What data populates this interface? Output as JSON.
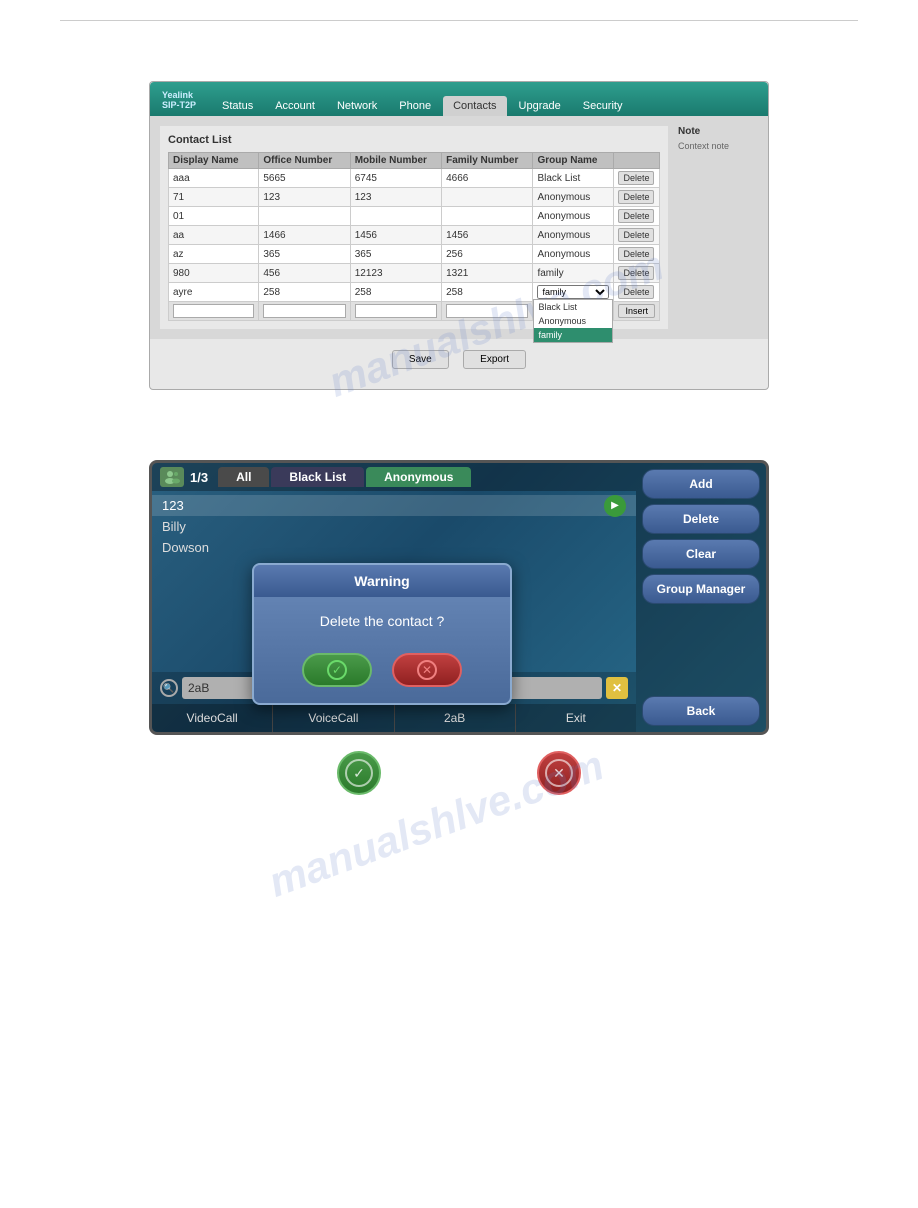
{
  "web_ui": {
    "logo": "Yealink",
    "logo_sub": "SIP-T2P",
    "nav": {
      "tabs": [
        "Status",
        "Account",
        "Network",
        "Phone",
        "Contacts",
        "Upgrade",
        "Security"
      ],
      "active": "Contacts"
    },
    "contact_list": {
      "title": "Contact List",
      "columns": [
        "Display Name",
        "Office Number",
        "Mobile Number",
        "Family Number",
        "Group Name"
      ],
      "rows": [
        {
          "name": "aaa",
          "office": "5665",
          "mobile": "6745",
          "family": "4666",
          "group": "Black List"
        },
        {
          "name": "71",
          "office": "123",
          "mobile": "123",
          "family": "",
          "group": "Anonymous"
        },
        {
          "name": "01",
          "office": "",
          "mobile": "",
          "family": "",
          "group": "Anonymous"
        },
        {
          "name": "aa",
          "office": "1466",
          "mobile": "1456",
          "family": "1456",
          "group": "Anonymous"
        },
        {
          "name": "az",
          "office": "365",
          "mobile": "365",
          "family": "256",
          "group": "Anonymous"
        },
        {
          "name": "980",
          "office": "456",
          "mobile": "12123",
          "family": "1321",
          "group": "family"
        },
        {
          "name": "ayre",
          "office": "258",
          "mobile": "258",
          "family": "258",
          "group": "family"
        }
      ],
      "dropdown_options": [
        "Black List",
        "Anonymous",
        "family"
      ],
      "selected_dropdown": "family",
      "insert_placeholder": "",
      "insert_group_default": "Anonymous",
      "insert_btn": "Insert"
    },
    "note": {
      "title": "Note",
      "text": "Context note"
    },
    "footer": {
      "save_btn": "Save",
      "export_btn": "Export"
    }
  },
  "phone_ui": {
    "counter": "1/3",
    "tabs": [
      {
        "label": "All",
        "type": "all"
      },
      {
        "label": "Black List",
        "type": "blacklist"
      },
      {
        "label": "Anonymous",
        "type": "anonymous"
      }
    ],
    "contacts": [
      {
        "name": "123",
        "selected": true
      },
      {
        "name": "Billy"
      },
      {
        "name": "Dowson"
      }
    ],
    "sidebar_buttons": [
      "Add",
      "Delete",
      "Clear",
      "Group Manager"
    ],
    "back_btn": "Back",
    "warning_dialog": {
      "title": "Warning",
      "message": "Delete the contact ?",
      "confirm_label": "✓",
      "cancel_label": "✕"
    },
    "search_bar": {
      "value": "2aB",
      "placeholder": ""
    },
    "bottom_bar": [
      "VideoCall",
      "VoiceCall",
      "2aB",
      "Exit"
    ]
  },
  "bottom_icons": {
    "confirm_icon": "✓",
    "cancel_icon": "✕"
  },
  "watermark": "manualshlve.com"
}
